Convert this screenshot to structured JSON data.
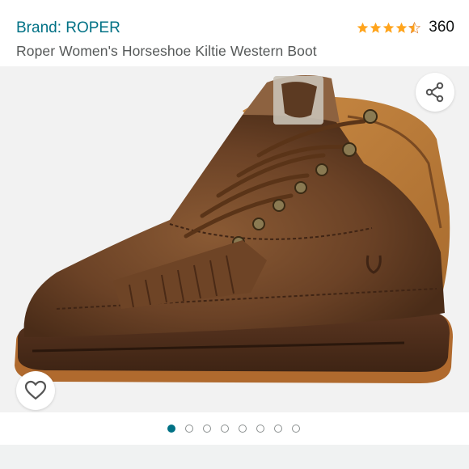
{
  "product": {
    "brand_link": "Brand: ROPER",
    "title": "Roper Women's Horseshoe Kiltie Western Boot",
    "rating": {
      "value": 4.5,
      "count": "360",
      "star_color": "#FFA41C"
    }
  },
  "gallery": {
    "image_count": 8,
    "active_index": 0,
    "image_description_icon": "boot-image"
  },
  "icons": {
    "share": "share-icon",
    "wishlist": "heart-icon"
  },
  "colors": {
    "link": "#007185",
    "star": "#FFA41C",
    "dot_active": "#007185"
  }
}
